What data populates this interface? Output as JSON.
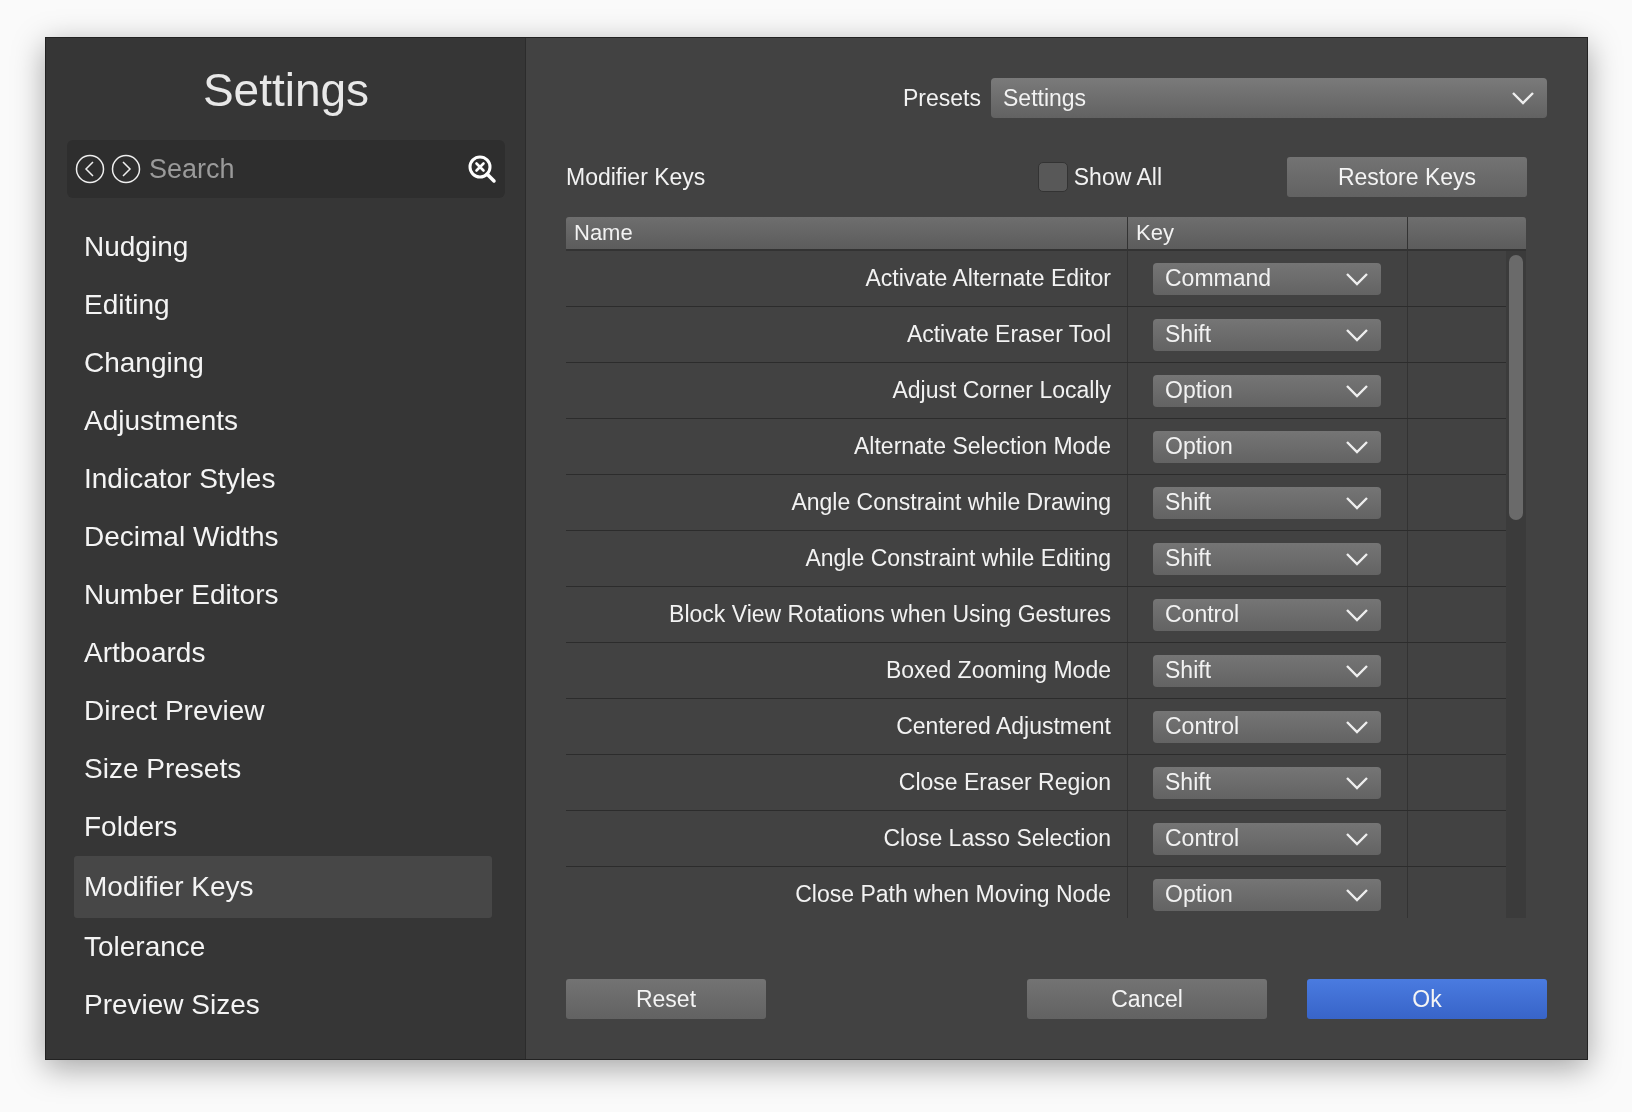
{
  "sidebar": {
    "title": "Settings",
    "search": {
      "placeholder": "Search"
    },
    "items": [
      {
        "label": "Nudging",
        "selected": false
      },
      {
        "label": "Editing",
        "selected": false
      },
      {
        "label": "Changing",
        "selected": false
      },
      {
        "label": "Adjustments",
        "selected": false
      },
      {
        "label": "Indicator Styles",
        "selected": false
      },
      {
        "label": "Decimal Widths",
        "selected": false
      },
      {
        "label": "Number Editors",
        "selected": false
      },
      {
        "label": "Artboards",
        "selected": false
      },
      {
        "label": "Direct Preview",
        "selected": false
      },
      {
        "label": "Size Presets",
        "selected": false
      },
      {
        "label": "Folders",
        "selected": false
      },
      {
        "label": "Modifier Keys",
        "selected": true
      },
      {
        "label": "Tolerance",
        "selected": false
      },
      {
        "label": "Preview Sizes",
        "selected": false
      }
    ]
  },
  "presets": {
    "label": "Presets",
    "value": "Settings"
  },
  "section": {
    "title": "Modifier Keys",
    "show_all": {
      "label": "Show All",
      "checked": false
    },
    "restore_button": "Restore Keys"
  },
  "table": {
    "columns": [
      "Name",
      "Key"
    ],
    "rows": [
      {
        "name": "Activate Alternate Editor",
        "key": "Command"
      },
      {
        "name": "Activate Eraser Tool",
        "key": "Shift"
      },
      {
        "name": "Adjust Corner Locally",
        "key": "Option"
      },
      {
        "name": "Alternate Selection Mode",
        "key": "Option"
      },
      {
        "name": "Angle Constraint while Drawing",
        "key": "Shift"
      },
      {
        "name": "Angle Constraint while Editing",
        "key": "Shift"
      },
      {
        "name": "Block View Rotations when Using Gestures",
        "key": "Control"
      },
      {
        "name": "Boxed Zooming Mode",
        "key": "Shift"
      },
      {
        "name": "Centered Adjustment",
        "key": "Control"
      },
      {
        "name": "Close Eraser Region",
        "key": "Shift"
      },
      {
        "name": "Close Lasso Selection",
        "key": "Control"
      },
      {
        "name": "Close Path when Moving Node",
        "key": "Option"
      }
    ]
  },
  "buttons": [
    {
      "label": "Reset",
      "kind": "plain"
    },
    {
      "label": "Cancel",
      "kind": "plain"
    },
    {
      "label": "Ok",
      "kind": "primary"
    }
  ]
}
